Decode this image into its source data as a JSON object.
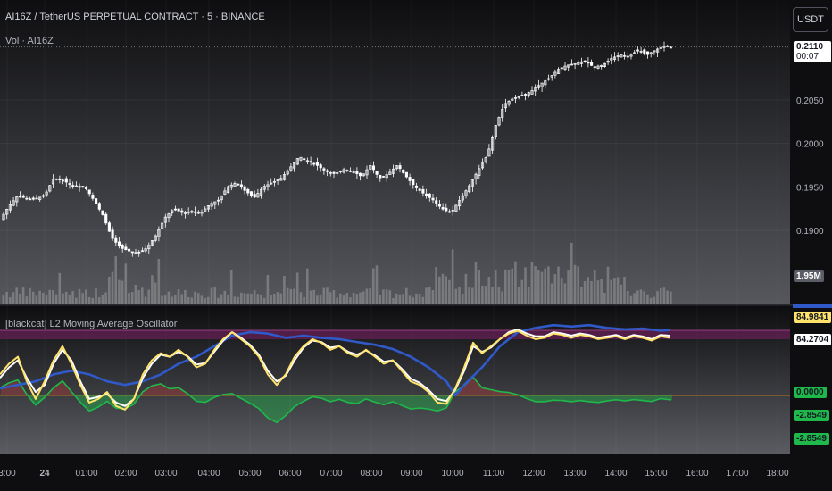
{
  "header": {
    "symbol_line": "AI16Z / TetherUS PERPETUAL CONTRACT · 5 · BINANCE",
    "volume_label": "Vol · AI16Z",
    "currency_button": "USDT"
  },
  "indicator": {
    "title": "[blackcat] L2 Moving Average Oscillator"
  },
  "price_axis": {
    "ticks": [
      "0.2050",
      "0.2000",
      "0.1950",
      "0.1900"
    ],
    "last_price": "0.2110",
    "countdown": "00:07",
    "volume_tag": "1.95M"
  },
  "osc_axis": {
    "tag_high1": "84.9841",
    "tag_high2": "84.2704",
    "tag_zero": "0.0000",
    "tag_neg1": "-2.8549",
    "tag_neg2": "-2.8549"
  },
  "time_axis": [
    "3:00",
    "24",
    "01:00",
    "02:00",
    "03:00",
    "04:00",
    "05:00",
    "06:00",
    "07:00",
    "08:00",
    "09:00",
    "10:00",
    "11:00",
    "12:00",
    "13:00",
    "14:00",
    "15:00",
    "16:00",
    "17:00",
    "18:00"
  ],
  "colors": {
    "candle": "#ffffff",
    "volume": "#9a9a9a",
    "fast_line": "#ffe36a",
    "slow_line": "#ffffff",
    "blue_line": "#3059c9",
    "positive_area": "#b23a3a",
    "negative_area": "#1fb84a",
    "overbought_band": "#6a1f5a",
    "zero_line": "#b2771f"
  },
  "chart_data": [
    {
      "type": "candlestick",
      "title": "AI16Z / TetherUS PERPETUAL CONTRACT · 5 · BINANCE",
      "ylim": [
        0.186,
        0.212
      ],
      "x_ticks": [
        "3:00",
        "24",
        "01:00",
        "02:00",
        "03:00",
        "04:00",
        "05:00",
        "06:00",
        "07:00",
        "08:00",
        "09:00",
        "10:00",
        "11:00",
        "12:00",
        "13:00",
        "14:00",
        "15:00",
        "16:00",
        "17:00",
        "18:00"
      ],
      "close_path": [
        [
          0,
          0.1912
        ],
        [
          10,
          0.1928
        ],
        [
          20,
          0.194
        ],
        [
          35,
          0.1935
        ],
        [
          50,
          0.194
        ],
        [
          60,
          0.196
        ],
        [
          70,
          0.1958
        ],
        [
          80,
          0.1952
        ],
        [
          95,
          0.195
        ],
        [
          105,
          0.1935
        ],
        [
          115,
          0.1918
        ],
        [
          125,
          0.1892
        ],
        [
          135,
          0.188
        ],
        [
          145,
          0.1876
        ],
        [
          155,
          0.1874
        ],
        [
          165,
          0.188
        ],
        [
          175,
          0.1895
        ],
        [
          185,
          0.1915
        ],
        [
          195,
          0.1925
        ],
        [
          205,
          0.192
        ],
        [
          215,
          0.1922
        ],
        [
          225,
          0.192
        ],
        [
          235,
          0.193
        ],
        [
          245,
          0.1935
        ],
        [
          255,
          0.195
        ],
        [
          265,
          0.1955
        ],
        [
          275,
          0.1945
        ],
        [
          285,
          0.1938
        ],
        [
          295,
          0.195
        ],
        [
          305,
          0.1955
        ],
        [
          315,
          0.196
        ],
        [
          325,
          0.1972
        ],
        [
          335,
          0.1985
        ],
        [
          345,
          0.198
        ],
        [
          355,
          0.1975
        ],
        [
          365,
          0.1968
        ],
        [
          375,
          0.1965
        ],
        [
          385,
          0.197
        ],
        [
          395,
          0.1968
        ],
        [
          405,
          0.1962
        ],
        [
          415,
          0.1975
        ],
        [
          425,
          0.196
        ],
        [
          435,
          0.1965
        ],
        [
          445,
          0.1975
        ],
        [
          455,
          0.1962
        ],
        [
          465,
          0.195
        ],
        [
          475,
          0.1942
        ],
        [
          485,
          0.1935
        ],
        [
          495,
          0.1925
        ],
        [
          505,
          0.192
        ],
        [
          515,
          0.1935
        ],
        [
          525,
          0.195
        ],
        [
          535,
          0.1968
        ],
        [
          545,
          0.1985
        ],
        [
          550,
          0.2
        ],
        [
          555,
          0.202
        ],
        [
          565,
          0.2045
        ],
        [
          575,
          0.2052
        ],
        [
          585,
          0.2055
        ],
        [
          595,
          0.206
        ],
        [
          605,
          0.2068
        ],
        [
          615,
          0.2075
        ],
        [
          625,
          0.2085
        ],
        [
          635,
          0.209
        ],
        [
          645,
          0.2092
        ],
        [
          655,
          0.2095
        ],
        [
          665,
          0.2088
        ],
        [
          675,
          0.209
        ],
        [
          685,
          0.2098
        ],
        [
          695,
          0.2102
        ],
        [
          705,
          0.21
        ],
        [
          715,
          0.2108
        ],
        [
          725,
          0.2102
        ],
        [
          735,
          0.2108
        ],
        [
          745,
          0.2112
        ],
        [
          755,
          0.211
        ]
      ]
    },
    {
      "type": "bar",
      "title": "Vol · AI16Z",
      "last_value": "1.95M"
    },
    {
      "type": "line",
      "title": "[blackcat] L2 Moving Average Oscillator",
      "series": [
        {
          "name": "",
          "color": "#ffe36a",
          "values": [
            [
              0,
              30
            ],
            [
              10,
              45
            ],
            [
              20,
              55
            ],
            [
              30,
              20
            ],
            [
              40,
              -5
            ],
            [
              50,
              20
            ],
            [
              60,
              50
            ],
            [
              70,
              70
            ],
            [
              80,
              45
            ],
            [
              90,
              15
            ],
            [
              100,
              -10
            ],
            [
              110,
              -5
            ],
            [
              120,
              5
            ],
            [
              130,
              -15
            ],
            [
              140,
              -20
            ],
            [
              150,
              -5
            ],
            [
              160,
              30
            ],
            [
              170,
              50
            ],
            [
              180,
              60
            ],
            [
              190,
              55
            ],
            [
              200,
              65
            ],
            [
              210,
              55
            ],
            [
              220,
              40
            ],
            [
              230,
              45
            ],
            [
              240,
              65
            ],
            [
              250,
              80
            ],
            [
              260,
              90
            ],
            [
              270,
              80
            ],
            [
              280,
              70
            ],
            [
              290,
              55
            ],
            [
              300,
              30
            ],
            [
              310,
              15
            ],
            [
              320,
              30
            ],
            [
              330,
              55
            ],
            [
              340,
              70
            ],
            [
              350,
              80
            ],
            [
              360,
              75
            ],
            [
              370,
              65
            ],
            [
              380,
              70
            ],
            [
              390,
              60
            ],
            [
              400,
              55
            ],
            [
              410,
              65
            ],
            [
              420,
              55
            ],
            [
              430,
              45
            ],
            [
              440,
              50
            ],
            [
              450,
              35
            ],
            [
              460,
              20
            ],
            [
              470,
              15
            ],
            [
              480,
              5
            ],
            [
              490,
              -10
            ],
            [
              500,
              -12
            ],
            [
              510,
              10
            ],
            [
              520,
              40
            ],
            [
              530,
              75
            ],
            [
              540,
              60
            ],
            [
              550,
              70
            ],
            [
              560,
              80
            ],
            [
              570,
              88
            ],
            [
              580,
              92
            ],
            [
              590,
              85
            ],
            [
              600,
              80
            ],
            [
              610,
              82
            ],
            [
              620,
              88
            ],
            [
              630,
              86
            ],
            [
              640,
              82
            ],
            [
              650,
              86
            ],
            [
              660,
              84
            ],
            [
              670,
              80
            ],
            [
              680,
              82
            ],
            [
              690,
              84
            ],
            [
              700,
              80
            ],
            [
              710,
              84
            ],
            [
              720,
              82
            ],
            [
              730,
              78
            ],
            [
              740,
              84
            ],
            [
              750,
              82
            ]
          ]
        },
        {
          "name": "",
          "color": "#ffffff",
          "values": [
            [
              0,
              25
            ],
            [
              10,
              40
            ],
            [
              20,
              50
            ],
            [
              30,
              25
            ],
            [
              40,
              5
            ],
            [
              50,
              15
            ],
            [
              60,
              45
            ],
            [
              70,
              65
            ],
            [
              80,
              50
            ],
            [
              90,
              20
            ],
            [
              100,
              -5
            ],
            [
              110,
              -2
            ],
            [
              120,
              2
            ],
            [
              130,
              -10
            ],
            [
              140,
              -15
            ],
            [
              150,
              -5
            ],
            [
              160,
              25
            ],
            [
              170,
              45
            ],
            [
              180,
              58
            ],
            [
              190,
              55
            ],
            [
              200,
              62
            ],
            [
              210,
              56
            ],
            [
              220,
              44
            ],
            [
              230,
              46
            ],
            [
              240,
              62
            ],
            [
              250,
              78
            ],
            [
              260,
              90
            ],
            [
              270,
              82
            ],
            [
              280,
              72
            ],
            [
              290,
              58
            ],
            [
              300,
              35
            ],
            [
              310,
              20
            ],
            [
              320,
              28
            ],
            [
              330,
              50
            ],
            [
              340,
              68
            ],
            [
              350,
              78
            ],
            [
              360,
              76
            ],
            [
              370,
              68
            ],
            [
              380,
              70
            ],
            [
              390,
              62
            ],
            [
              400,
              58
            ],
            [
              410,
              64
            ],
            [
              420,
              57
            ],
            [
              430,
              48
            ],
            [
              440,
              50
            ],
            [
              450,
              38
            ],
            [
              460,
              24
            ],
            [
              470,
              18
            ],
            [
              480,
              8
            ],
            [
              490,
              -5
            ],
            [
              500,
              -8
            ],
            [
              510,
              8
            ],
            [
              520,
              35
            ],
            [
              530,
              70
            ],
            [
              540,
              62
            ],
            [
              550,
              68
            ],
            [
              560,
              80
            ],
            [
              570,
              90
            ],
            [
              580,
              94
            ],
            [
              590,
              88
            ],
            [
              600,
              84
            ],
            [
              610,
              84
            ],
            [
              620,
              90
            ],
            [
              630,
              88
            ],
            [
              640,
              85
            ],
            [
              650,
              88
            ],
            [
              660,
              86
            ],
            [
              670,
              82
            ],
            [
              680,
              84
            ],
            [
              690,
              86
            ],
            [
              700,
              82
            ],
            [
              710,
              86
            ],
            [
              720,
              84
            ],
            [
              730,
              80
            ],
            [
              740,
              86
            ],
            [
              750,
              85
            ]
          ]
        },
        {
          "name": "",
          "color": "#3059c9",
          "values": [
            [
              0,
              10
            ],
            [
              20,
              15
            ],
            [
              40,
              20
            ],
            [
              60,
              30
            ],
            [
              80,
              35
            ],
            [
              100,
              30
            ],
            [
              120,
              20
            ],
            [
              140,
              15
            ],
            [
              160,
              20
            ],
            [
              180,
              30
            ],
            [
              200,
              45
            ],
            [
              220,
              55
            ],
            [
              240,
              70
            ],
            [
              260,
              85
            ],
            [
              280,
              90
            ],
            [
              300,
              88
            ],
            [
              320,
              82
            ],
            [
              340,
              85
            ],
            [
              360,
              82
            ],
            [
              380,
              80
            ],
            [
              400,
              76
            ],
            [
              420,
              72
            ],
            [
              440,
              66
            ],
            [
              460,
              55
            ],
            [
              480,
              40
            ],
            [
              500,
              20
            ],
            [
              510,
              0
            ],
            [
              520,
              15
            ],
            [
              540,
              40
            ],
            [
              560,
              70
            ],
            [
              580,
              90
            ],
            [
              600,
              96
            ],
            [
              620,
              100
            ],
            [
              640,
              98
            ],
            [
              660,
              100
            ],
            [
              680,
              96
            ],
            [
              700,
              94
            ],
            [
              720,
              95
            ],
            [
              740,
              92
            ],
            [
              750,
              93
            ]
          ]
        }
      ],
      "ylim": [
        -60,
        100
      ]
    }
  ]
}
